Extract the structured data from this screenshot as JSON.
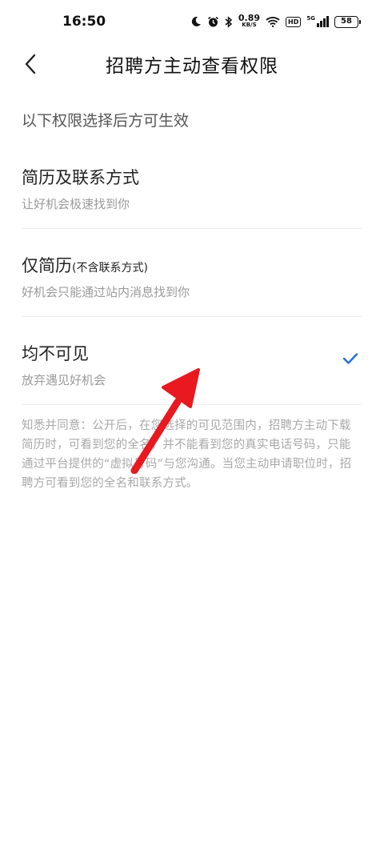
{
  "status_bar": {
    "time": "16:50",
    "net_speed_value": "0.89",
    "net_speed_unit": "KB/S",
    "hd_label": "HD",
    "signal_label": "5G",
    "battery": "58"
  },
  "header": {
    "title": "招聘方主动查看权限",
    "back_icon": "chevron-left-icon"
  },
  "intro_text": "以下权限选择后方可生效",
  "options": [
    {
      "title": "简历及联系方式",
      "subtitle": "",
      "desc": "让好机会极速找到你",
      "selected": false
    },
    {
      "title": "仅简历",
      "subtitle": "(不含联系方式)",
      "desc": "好机会只能通过站内消息找到你",
      "selected": false
    },
    {
      "title": "均不可见",
      "subtitle": "",
      "desc": "放弃遇见好机会",
      "selected": true
    }
  ],
  "note": "知悉并同意：公开后，在您选择的可见范围内，招聘方主动下载简历时，可看到您的全名，并不能看到您的真实电话号码，只能通过平台提供的“虚拟号码”与您沟通。当您主动申请职位时，招聘方可看到您的全名和联系方式。",
  "colors": {
    "accent": "#1f6fe0",
    "annotation_arrow": "#e8191f",
    "desc_text": "#9b9b9b"
  }
}
